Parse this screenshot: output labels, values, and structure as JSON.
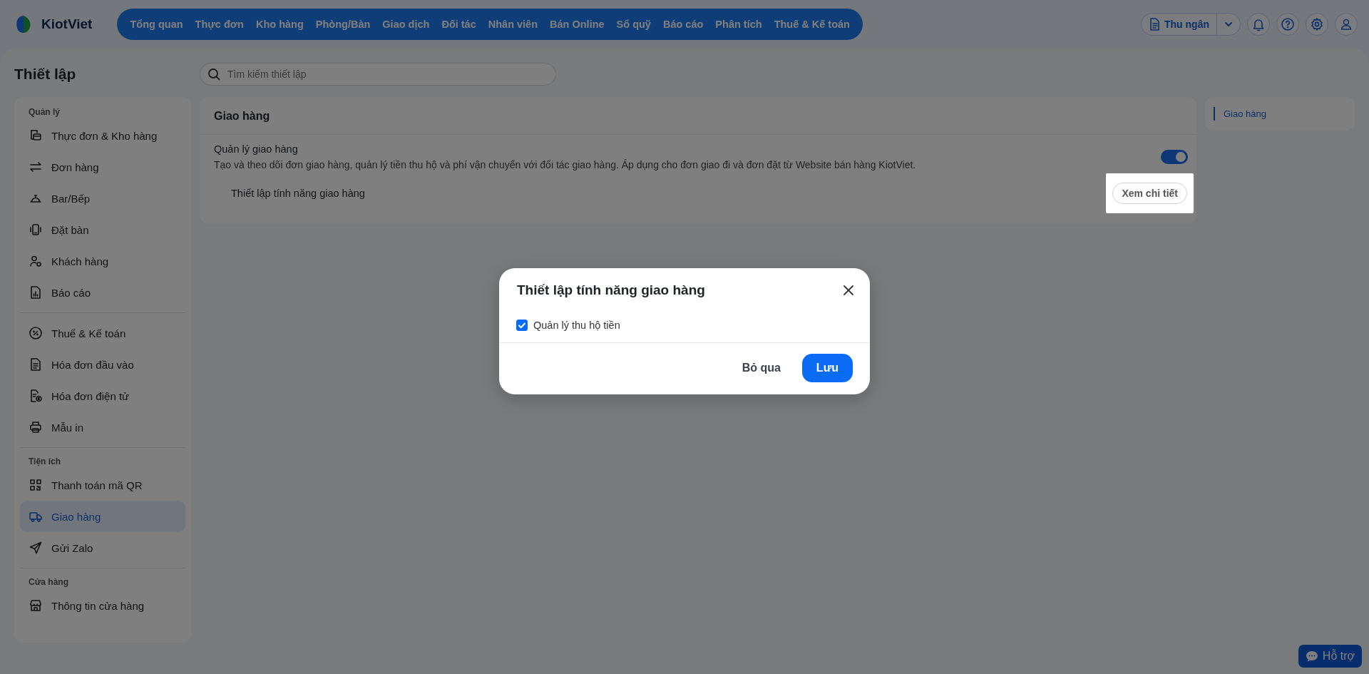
{
  "brand": {
    "name": "KiotViet"
  },
  "nav": [
    {
      "label": "Tổng quan"
    },
    {
      "label": "Thực đơn"
    },
    {
      "label": "Kho hàng"
    },
    {
      "label": "Phòng/Bàn"
    },
    {
      "label": "Giao dịch"
    },
    {
      "label": "Đối tác"
    },
    {
      "label": "Nhân viên"
    },
    {
      "label": "Bán Online"
    },
    {
      "label": "Sổ quỹ"
    },
    {
      "label": "Báo cáo"
    },
    {
      "label": "Phân tích"
    },
    {
      "label": "Thuế & Kế toán"
    }
  ],
  "toolbar": {
    "role_button": "Thu ngân"
  },
  "page": {
    "title": "Thiết lập",
    "search": {
      "placeholder": "Tìm kiếm thiết lập"
    }
  },
  "sidebar": {
    "sections": [
      {
        "label": "Quản lý",
        "items": [
          {
            "label": "Thực đơn & Kho hàng",
            "selected": false
          },
          {
            "label": "Đơn hàng",
            "selected": false
          },
          {
            "label": "Bar/Bếp",
            "selected": false
          },
          {
            "label": "Đặt bàn",
            "selected": false
          },
          {
            "label": "Khách hàng",
            "selected": false
          },
          {
            "label": "Báo cáo",
            "selected": false
          }
        ]
      },
      {
        "items": [
          {
            "label": "Thuế & Kế toán",
            "selected": false
          },
          {
            "label": "Hóa đơn đầu vào",
            "selected": false
          },
          {
            "label": "Hóa đơn điện tử",
            "selected": false
          },
          {
            "label": "Mẫu in",
            "selected": false
          }
        ]
      },
      {
        "label": "Tiện ích",
        "items": [
          {
            "label": "Thanh toán mã QR",
            "selected": false
          },
          {
            "label": "Giao hàng",
            "selected": true
          },
          {
            "label": "Gửi Zalo",
            "selected": false
          }
        ]
      },
      {
        "label": "Cửa hàng",
        "items": [
          {
            "label": "Thông tin cửa hàng",
            "selected": false
          }
        ]
      }
    ]
  },
  "section": {
    "title": "Giao hàng",
    "settings": [
      {
        "title": "Quản lý giao hàng",
        "description": "Tạo và theo dõi đơn giao hàng, quản lý tiền thu hộ và phí vận chuyển với đối tác giao hàng. Áp dụng cho đơn giao đi và đơn đặt từ Website bán hàng KiotViet.",
        "on": true,
        "sub": {
          "label": "Thiết lập tính năng giao hàng",
          "button": "Xem chi tiết",
          "highlighted": true
        }
      }
    ]
  },
  "toc": [
    {
      "label": "Giao hàng",
      "selected": true
    }
  ],
  "dialog": {
    "title": "Thiết lập tính năng giao hàng",
    "options": [
      {
        "label": "Quản lý thu hộ tiền",
        "checked": true
      }
    ],
    "buttons": [
      {
        "label": "Bỏ qua",
        "kind": "secondary"
      },
      {
        "label": "Lưu",
        "kind": "primary"
      }
    ]
  },
  "support": {
    "label": "Hỗ trợ"
  }
}
